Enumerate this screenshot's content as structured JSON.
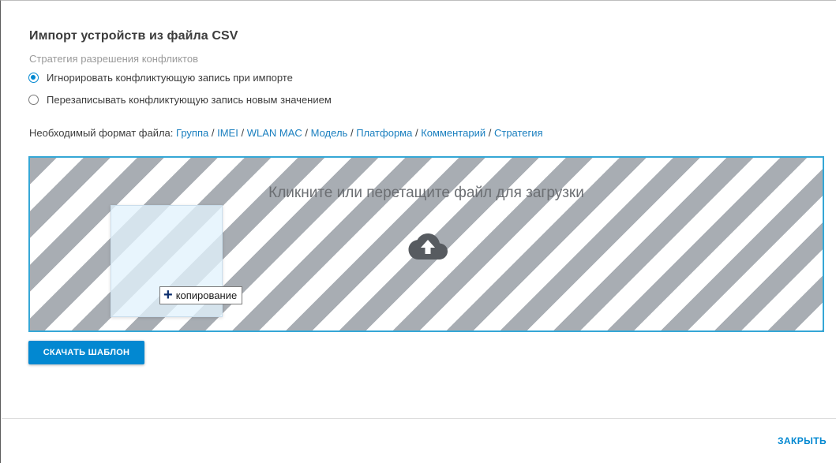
{
  "dialog": {
    "title": "Импорт устройств из файла CSV",
    "strategy_label": "Стратегия разрешения конфликтов",
    "options": [
      {
        "label": "Игнорировать конфликтующую запись при импорте",
        "checked": true
      },
      {
        "label": "Перезаписывать конфликтующую запись новым значением",
        "checked": false
      }
    ],
    "format": {
      "prefix": "Необходимый формат файла:",
      "fields": [
        "Группа",
        "IMEI",
        "WLAN MAC",
        "Модель",
        "Платформа",
        "Комментарий",
        "Стратегия"
      ],
      "separator": "/"
    },
    "dropzone": {
      "text": "Кликните или перетащите файл для загрузки",
      "icon": "cloud-upload-icon",
      "drag_tooltip": "копирование"
    },
    "download_button": "СКАЧАТЬ ШАБЛОН",
    "close_button": "ЗАКРЫТЬ"
  },
  "colors": {
    "accent": "#0288d1",
    "link": "#1a7fbf",
    "dropzone_border": "#35a7d6",
    "stripe_dark": "#a8adb3"
  }
}
